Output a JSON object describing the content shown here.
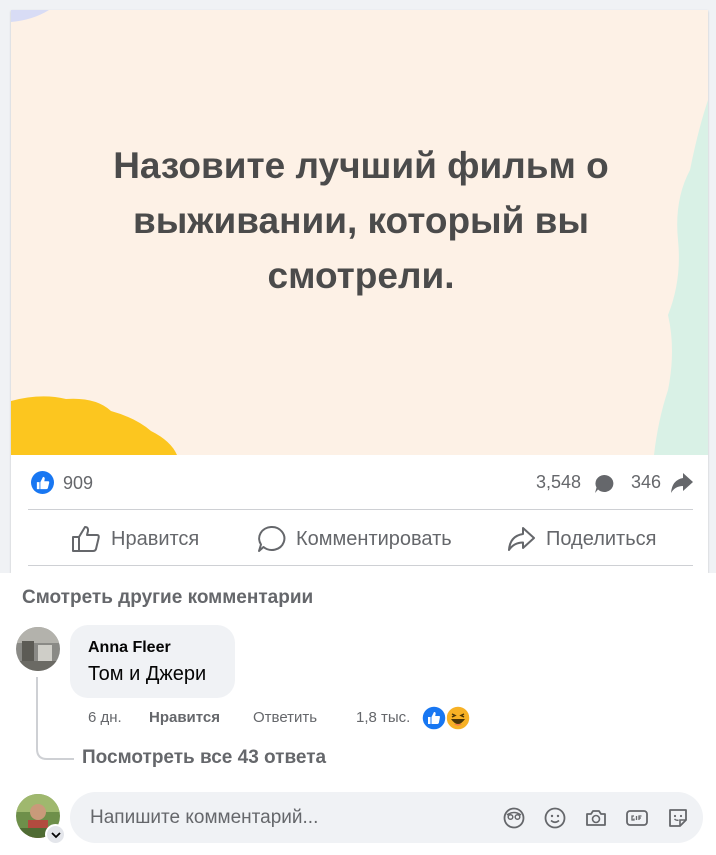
{
  "post": {
    "text": "Назовите лучший фильм о выживании, который вы смотрели.",
    "colors": {
      "background": "#fdf1e6",
      "yellow_blob": "#fcc61f",
      "mint_blob": "#d9f1e6",
      "text": "#4b4b4b"
    }
  },
  "stats": {
    "likes": "909",
    "comments": "3,548",
    "shares": "346"
  },
  "actions": {
    "like_label": "Нравится",
    "comment_label": "Комментировать",
    "share_label": "Поделиться"
  },
  "comments": {
    "view_more": "Смотреть другие комментарии",
    "items": [
      {
        "author": "Anna Fleer",
        "text": "Том и Джери",
        "time": "6 дн.",
        "like_label": "Нравится",
        "reply_label": "Ответить",
        "reaction_count": "1,8 тыс.",
        "reactions": [
          "like-icon",
          "haha-icon"
        ]
      }
    ],
    "view_replies": "Посмотреть все 43 ответа"
  },
  "composer": {
    "placeholder": "Напишите комментарий...",
    "icons": [
      "avatar-sticker-icon",
      "emoji-icon",
      "camera-icon",
      "gif-icon",
      "sticker-icon"
    ]
  },
  "colors": {
    "accent": "#1877f2",
    "secondary_text": "#65676b",
    "bubble": "#f0f2f5"
  }
}
